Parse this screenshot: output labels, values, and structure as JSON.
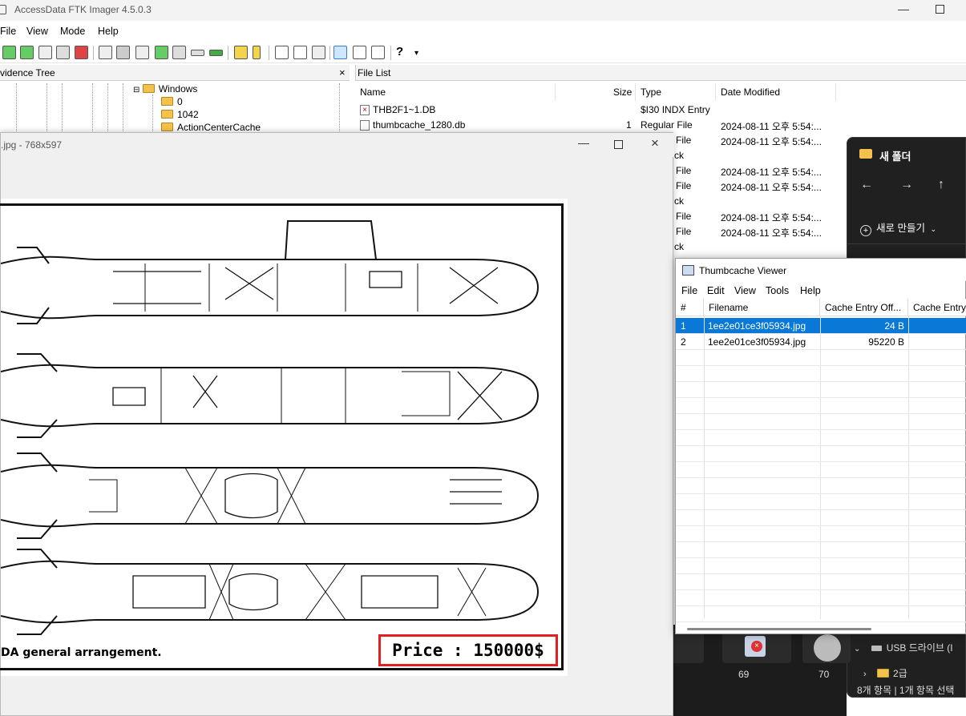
{
  "ftk": {
    "title": "AccessData FTK Imager 4.5.0.3",
    "menu": [
      "File",
      "View",
      "Mode",
      "Help"
    ],
    "evidence_tree_title": "vidence Tree",
    "file_list_title": "File List",
    "tree": [
      "Windows",
      "0",
      "1042",
      "ActionCenterCache"
    ],
    "columns": [
      "Name",
      "Size",
      "Type",
      "Date Modified"
    ],
    "files": [
      {
        "name": "THB2F1~1.DB",
        "size": "",
        "type": "$I30 INDX Entry",
        "date": ""
      },
      {
        "name": "thumbcache_1280.db",
        "size": "1",
        "type": "Regular File",
        "date": "2024-08-11 오후 5:54:..."
      }
    ],
    "partial_rows": [
      {
        "type": "File",
        "date": "2024-08-11 오후 5:54:..."
      },
      {
        "type": "ck",
        "date": ""
      },
      {
        "type": "File",
        "date": "2024-08-11 오후 5:54:..."
      },
      {
        "type": "File",
        "date": "2024-08-11 오후 5:54:..."
      },
      {
        "type": "ck",
        "date": ""
      },
      {
        "type": "File",
        "date": "2024-08-11 오후 5:54:..."
      },
      {
        "type": "File",
        "date": "2024-08-11 오후 5:54:..."
      },
      {
        "type": "ck",
        "date": ""
      }
    ]
  },
  "viewer": {
    "title": ".jpg - 768x597",
    "caption": "DA general arrangement.",
    "price": "Price : 150000$"
  },
  "explorer": {
    "folder_title": "새 폴더",
    "new_button": "새로 만들기",
    "usb": "USB 드라이브 (I",
    "folder2": "2급",
    "status": "8개 항목  |  1개 항목 선택"
  },
  "thumbs": [
    "69",
    "70"
  ],
  "tcv": {
    "title": "Thumbcache Viewer",
    "menu": [
      "File",
      "Edit",
      "View",
      "Tools",
      "Help"
    ],
    "columns": [
      "#",
      "Filename",
      "Cache Entry Off...",
      "Cache Entry"
    ],
    "rows": [
      {
        "num": "1",
        "filename": "1ee2e01ce3f05934.jpg",
        "offset": "24 B"
      },
      {
        "num": "2",
        "filename": "1ee2e01ce3f05934.jpg",
        "offset": "95220 B"
      }
    ]
  }
}
